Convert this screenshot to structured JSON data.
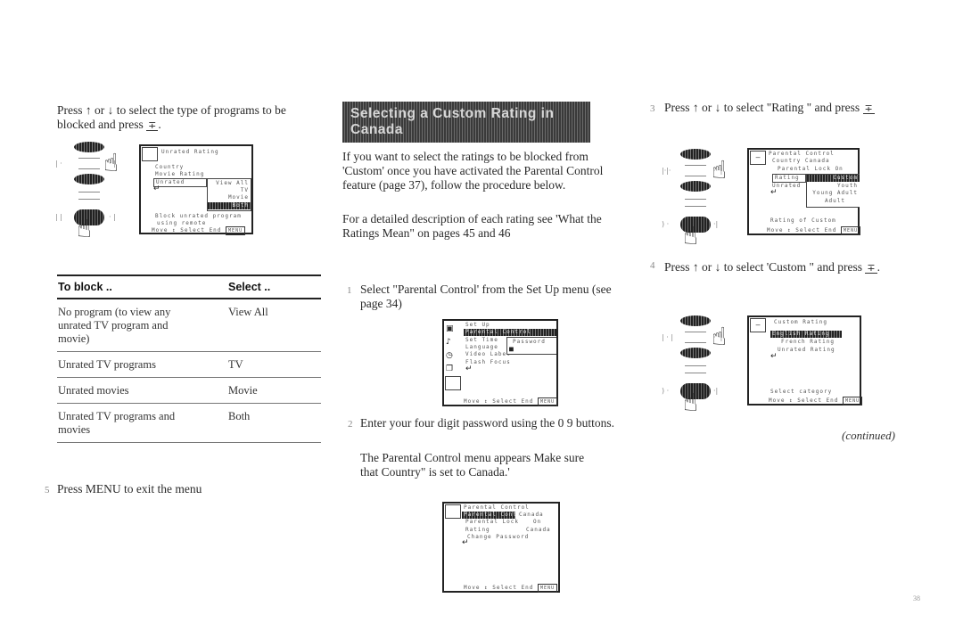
{
  "left_column": {
    "step_intro": "Press ↑ or ↓ to select the type of programs to be blocked and press",
    "enter_glyph": "∓",
    "screen1": {
      "title": "Unrated Rating",
      "lines": [
        "Country",
        "Movie Rating",
        "Unrated",
        "↵"
      ],
      "submenu": [
        "View All",
        "TV",
        "Movie",
        "Both"
      ],
      "footer_lines": [
        "Block unrated program",
        "using remote",
        "Move ↕  Select  End"
      ],
      "end_label": "MENU"
    },
    "table": {
      "headers": [
        "To block ..",
        "Select .."
      ],
      "rows": [
        {
          "block": "No program (to view any unrated TV program and movie)",
          "select": "View All"
        },
        {
          "block": "Unrated TV programs",
          "select": "TV"
        },
        {
          "block": "Unrated movies",
          "select": "Movie"
        },
        {
          "block": "Unrated TV programs and movies",
          "select": "Both"
        }
      ]
    },
    "step_exit_num": "5",
    "step_exit": "Press MENU to exit the menu"
  },
  "middle_column": {
    "heading": "Selecting a Custom Rating in Canada",
    "intro_p1": "If you want to select the ratings to be blocked from 'Custom' once you have activated the Parental Control feature (page 37), follow the procedure below.",
    "intro_p2": "For a detailed description of each rating see 'What the Ratings Mean\" on pages 45 and 46",
    "step1_num": "1",
    "step1": "Select \"Parental Control' from the Set Up menu (see page 34)",
    "screen_setup": {
      "title": "Set Up",
      "lines": [
        "Parental Control",
        "Set Time",
        "Language",
        "Video Label",
        "Flash Focus",
        "↵"
      ],
      "submenu": [
        "Password",
        "■"
      ],
      "footer": "Move ↕  Select  End",
      "end_label": "MENU"
    },
    "step2_num": "2",
    "step2": "Enter your four digit password using the 0 9 buttons.",
    "step2_p2": "The Parental Control menu appears Make sure that Country\" is set to Canada.'",
    "screen_parental": {
      "title": "Parental Control",
      "lines": [
        "Parental Control",
        "Parental Lock",
        "Rating",
        "Change Password",
        "↵"
      ],
      "values": [
        "Canada",
        "On",
        "Canada"
      ],
      "footer": "Move ↕  Select  End",
      "end_label": "MENU"
    }
  },
  "right_column": {
    "step3_num": "3",
    "step3": "Press ↑ or ↓ to select \"Rating \" and press",
    "screen_rating": {
      "title": "Parental Control",
      "lines": [
        "Country  Canada",
        "Parental Lock  On",
        "Rating",
        "Unrated",
        "↵"
      ],
      "submenu": [
        "Custom",
        "Youth",
        "Young Adult",
        "Adult"
      ],
      "footer_lines": [
        "Rating of Custom",
        "Move ↕  Select  End"
      ],
      "end_label": "MENU"
    },
    "step4_num": "4",
    "step4": "Press ↑ or ↓ to select 'Custom \" and press",
    "screen_custom": {
      "title": "Custom Rating",
      "lines": [
        "English Rating",
        "French Rating",
        "Unrated Rating",
        "↵"
      ],
      "footer_lines": [
        "Select category",
        "Move ↕  Select  End"
      ],
      "end_label": "MENU"
    },
    "continued": "(continued)"
  },
  "page_number": "38"
}
